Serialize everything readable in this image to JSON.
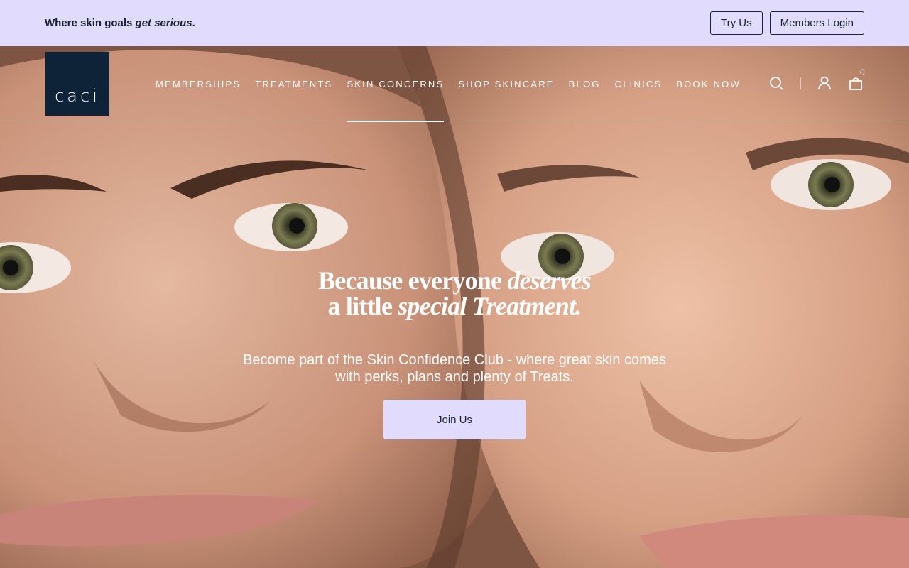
{
  "promo": {
    "text_prefix": "Where skin goals ",
    "text_emphasis": "get serious",
    "text_suffix": ".",
    "try_us_label": "Try Us",
    "members_login_label": "Members Login"
  },
  "header": {
    "logo_text": "caci",
    "nav": [
      {
        "label": "MEMBERSHIPS",
        "active": false
      },
      {
        "label": "TREATMENTS",
        "active": false
      },
      {
        "label": "SKIN CONCERNS",
        "active": true
      },
      {
        "label": "SHOP SKINCARE",
        "active": false
      },
      {
        "label": "BLOG",
        "active": false
      },
      {
        "label": "CLINICS",
        "active": false
      },
      {
        "label": "BOOK NOW",
        "active": false
      }
    ],
    "icons": [
      "search-icon",
      "account-icon",
      "cart-icon"
    ],
    "cart_count": "0"
  },
  "hero": {
    "heading_line1_regular": "Because everyone ",
    "heading_line1_italic": "deserves",
    "heading_line2_regular": "a little ",
    "heading_line2_italic": "special Treatment.",
    "subtext": "Become part of the Skin Confidence Club - where great skin comes with perks, plans and plenty of Treats.",
    "cta_label": "Join Us"
  },
  "colors": {
    "promo_bg": "#e1dcfd",
    "logo_bg": "#0f2338",
    "text_dark": "#1b2232",
    "cta_bg": "#e1dcfd"
  }
}
